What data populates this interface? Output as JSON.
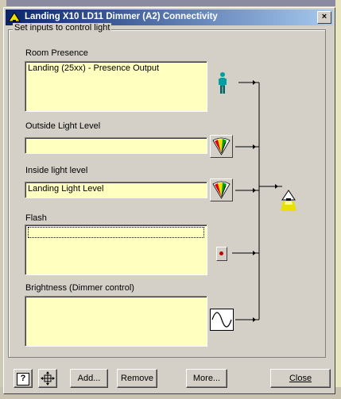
{
  "window": {
    "title": "Landing X10 LD11 Dimmer (A2) Connectivity",
    "close_glyph": "×"
  },
  "group": {
    "legend": "Set inputs to control light"
  },
  "inputs": [
    {
      "label": "Room Presence",
      "value": "Landing (25xx) - Presence Output",
      "icon": "person-icon"
    },
    {
      "label": "Outside Light Level",
      "value": "",
      "icon": "light-meter-icon"
    },
    {
      "label": "Inside light level",
      "value": "Landing Light Level",
      "icon": "light-meter-icon"
    },
    {
      "label": "Flash",
      "value": "",
      "icon": "flash-button-icon"
    },
    {
      "label": "Brightness (Dimmer control)",
      "value": "",
      "icon": "sine-wave-icon"
    }
  ],
  "buttons": {
    "help": "?",
    "add": "Add...",
    "remove": "Remove",
    "more": "More...",
    "close": "Close"
  },
  "colors": {
    "field_bg": "#ffffc0",
    "titlebar_start": "#0a246a",
    "titlebar_end": "#a6caf0",
    "lamp": "#e8e000"
  }
}
